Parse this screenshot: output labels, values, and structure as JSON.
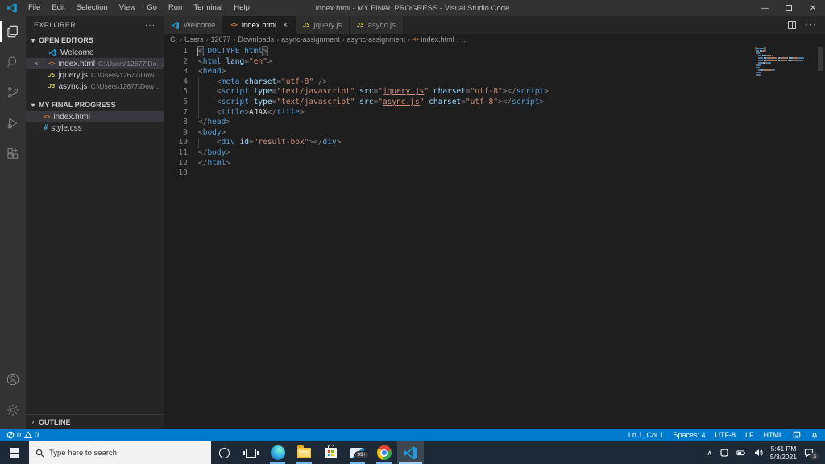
{
  "colors": {
    "accent": "#007acc",
    "statusbar": "#007acc",
    "editor_bg": "#1e1e1e",
    "tag": "#569cd6",
    "attribute": "#9cdcfe",
    "string": "#ce9178",
    "html_icon": "#e37933",
    "js_icon": "#cbcb41",
    "css_icon": "#519aba"
  },
  "window": {
    "title": "index.html - MY FINAL PROGRESS - Visual Studio Code",
    "menus": [
      "File",
      "Edit",
      "Selection",
      "View",
      "Go",
      "Run",
      "Terminal",
      "Help"
    ]
  },
  "activity_bar": {
    "items": [
      {
        "icon": "files-icon",
        "active": true
      },
      {
        "icon": "search-icon",
        "active": false
      },
      {
        "icon": "source-control-icon",
        "active": false
      },
      {
        "icon": "run-debug-icon",
        "active": false
      },
      {
        "icon": "extensions-icon",
        "active": false
      }
    ],
    "bottom": [
      {
        "icon": "account-icon"
      },
      {
        "icon": "settings-gear-icon"
      }
    ]
  },
  "sidebar": {
    "header": "EXPLORER",
    "header_more": "···",
    "open_editors": {
      "label": "OPEN EDITORS",
      "items": [
        {
          "icon": "vscode-icon",
          "label": "Welcome",
          "path": ""
        },
        {
          "icon": "html-file-icon",
          "label": "index.html",
          "path": "C:\\Users\\12677\\Downlo...",
          "close": "×",
          "selected": true
        },
        {
          "icon": "js-file-icon",
          "label": "jquery.js",
          "path": "C:\\Users\\12677\\Download..."
        },
        {
          "icon": "js-file-icon",
          "label": "async.js",
          "path": "C:\\Users\\12677\\Downloads..."
        }
      ]
    },
    "project": {
      "label": "MY FINAL PROGRESS",
      "items": [
        {
          "icon": "html-file-icon",
          "label": "index.html",
          "selected": true
        },
        {
          "icon": "css-file-icon",
          "label": "style.css"
        }
      ]
    },
    "outline_label": "OUTLINE"
  },
  "tabs": [
    {
      "icon": "vscode-icon",
      "label": "Welcome",
      "active": false
    },
    {
      "icon": "html-file-icon",
      "label": "index.html",
      "active": true,
      "close": "×"
    },
    {
      "icon": "js-file-icon",
      "label": "jquery.js",
      "active": false
    },
    {
      "icon": "js-file-icon",
      "label": "async.js",
      "active": false
    }
  ],
  "breadcrumbs": [
    "C:",
    "Users",
    "12677",
    "Downloads",
    "async-assignment",
    "async-assignment",
    "index.html",
    "..."
  ],
  "editor": {
    "language": "html",
    "lines": [
      [
        [
          "bm",
          "<"
        ],
        [
          "t",
          "!DOCTYPE html"
        ],
        [
          "bm",
          ">"
        ]
      ],
      [
        [
          "p",
          "<"
        ],
        [
          "t",
          "html"
        ],
        [
          "x",
          " "
        ],
        [
          "a",
          "lang"
        ],
        [
          "p",
          "="
        ],
        [
          "s",
          "\"en\""
        ],
        [
          "p",
          ">"
        ]
      ],
      [
        [
          "p",
          "<"
        ],
        [
          "t",
          "head"
        ],
        [
          "p",
          ">"
        ]
      ],
      [
        [
          "x",
          "    "
        ],
        [
          "p",
          "<"
        ],
        [
          "t",
          "meta"
        ],
        [
          "x",
          " "
        ],
        [
          "a",
          "charset"
        ],
        [
          "p",
          "="
        ],
        [
          "s",
          "\"utf-8\""
        ],
        [
          "x",
          " "
        ],
        [
          "p",
          "/>"
        ]
      ],
      [
        [
          "x",
          "    "
        ],
        [
          "p",
          "<"
        ],
        [
          "t",
          "script"
        ],
        [
          "x",
          " "
        ],
        [
          "a",
          "type"
        ],
        [
          "p",
          "="
        ],
        [
          "s",
          "\"text/javascript\""
        ],
        [
          "x",
          " "
        ],
        [
          "a",
          "src"
        ],
        [
          "p",
          "="
        ],
        [
          "s",
          "\""
        ],
        [
          "l",
          "jquery.js"
        ],
        [
          "s",
          "\""
        ],
        [
          "x",
          " "
        ],
        [
          "a",
          "charset"
        ],
        [
          "p",
          "="
        ],
        [
          "s",
          "\"utf-8\""
        ],
        [
          "p",
          "></"
        ],
        [
          "t",
          "script"
        ],
        [
          "p",
          ">"
        ]
      ],
      [
        [
          "x",
          "    "
        ],
        [
          "p",
          "<"
        ],
        [
          "t",
          "script"
        ],
        [
          "x",
          " "
        ],
        [
          "a",
          "type"
        ],
        [
          "p",
          "="
        ],
        [
          "s",
          "\"text/javascript\""
        ],
        [
          "x",
          " "
        ],
        [
          "a",
          "src"
        ],
        [
          "p",
          "="
        ],
        [
          "s",
          "\""
        ],
        [
          "l",
          "async.js"
        ],
        [
          "s",
          "\""
        ],
        [
          "x",
          " "
        ],
        [
          "a",
          "charset"
        ],
        [
          "p",
          "="
        ],
        [
          "s",
          "\"utf-8\""
        ],
        [
          "p",
          "></"
        ],
        [
          "t",
          "script"
        ],
        [
          "p",
          ">"
        ]
      ],
      [
        [
          "x",
          "    "
        ],
        [
          "p",
          "<"
        ],
        [
          "t",
          "title"
        ],
        [
          "p",
          ">"
        ],
        [
          "x",
          "AJAX"
        ],
        [
          "p",
          "</"
        ],
        [
          "t",
          "title"
        ],
        [
          "p",
          ">"
        ]
      ],
      [
        [
          "p",
          "</"
        ],
        [
          "t",
          "head"
        ],
        [
          "p",
          ">"
        ]
      ],
      [
        [
          "p",
          "<"
        ],
        [
          "t",
          "body"
        ],
        [
          "p",
          ">"
        ]
      ],
      [
        [
          "x",
          "    "
        ],
        [
          "p",
          "<"
        ],
        [
          "t",
          "div"
        ],
        [
          "x",
          " "
        ],
        [
          "a",
          "id"
        ],
        [
          "p",
          "="
        ],
        [
          "s",
          "\"result-box\""
        ],
        [
          "p",
          "></"
        ],
        [
          "t",
          "div"
        ],
        [
          "p",
          ">"
        ]
      ],
      [
        [
          "p",
          "</"
        ],
        [
          "t",
          "body"
        ],
        [
          "p",
          ">"
        ]
      ],
      [
        [
          "p",
          "</"
        ],
        [
          "t",
          "html"
        ],
        [
          "p",
          ">"
        ]
      ],
      []
    ]
  },
  "status_bar": {
    "errors": "0",
    "warnings": "0",
    "right": [
      "Ln 1, Col 1",
      "Spaces: 4",
      "UTF-8",
      "LF",
      "HTML"
    ]
  },
  "taskbar": {
    "search_placeholder": "Type here to search",
    "apps": [
      {
        "icon": "start-icon"
      },
      {
        "icon": "cortana-icon"
      },
      {
        "icon": "task-view-icon"
      },
      {
        "icon": "edge-icon",
        "running": true
      },
      {
        "icon": "file-explorer-icon",
        "running": true
      },
      {
        "icon": "store-icon",
        "running": false
      },
      {
        "icon": "mail-icon",
        "running": true,
        "badge": "99+"
      },
      {
        "icon": "chrome-icon",
        "running": true
      },
      {
        "icon": "vscode-icon",
        "running": true,
        "active": true
      }
    ],
    "mail_badge": "99+",
    "tray": {
      "time": "5:41 PM",
      "date": "5/3/2021",
      "notification_badge": "3"
    }
  }
}
